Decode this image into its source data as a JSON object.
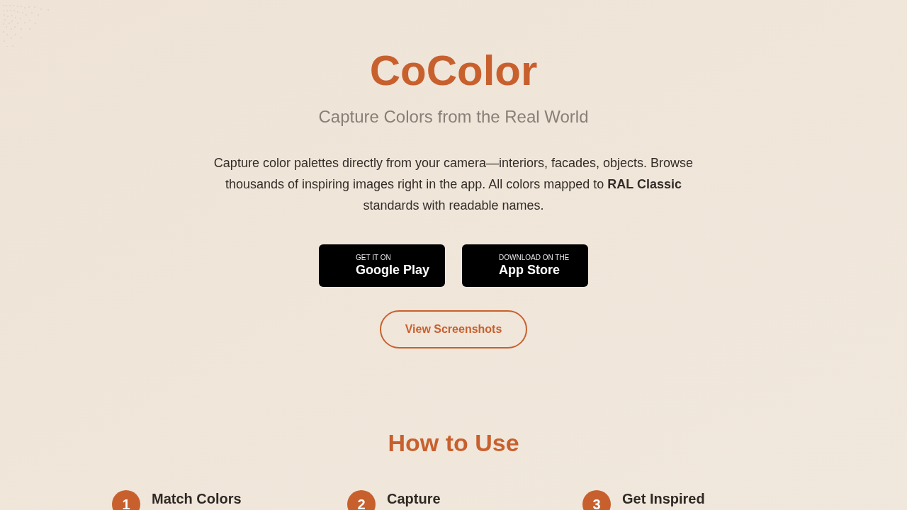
{
  "hero": {
    "title": "CoColor",
    "subtitle": "Capture Colors from the Real World",
    "description": "Capture color palettes directly from your camera—interiors, facades, objects. Browse thousands of inspiring images right in the app. All colors mapped to **RAL Classic** standards with readable names.",
    "store_buttons": [
      {
        "caption": "GET IT ON",
        "label": "Google Play"
      },
      {
        "caption": "DOWNLOAD ON THE",
        "label": "App Store"
      }
    ],
    "secondary_button": "View Screenshots"
  },
  "how_to_use": {
    "title": "How to Use",
    "steps": [
      {
        "number": "1",
        "title": "Match Colors"
      },
      {
        "number": "2",
        "title": "Capture"
      },
      {
        "number": "3",
        "title": "Get Inspired"
      }
    ]
  }
}
